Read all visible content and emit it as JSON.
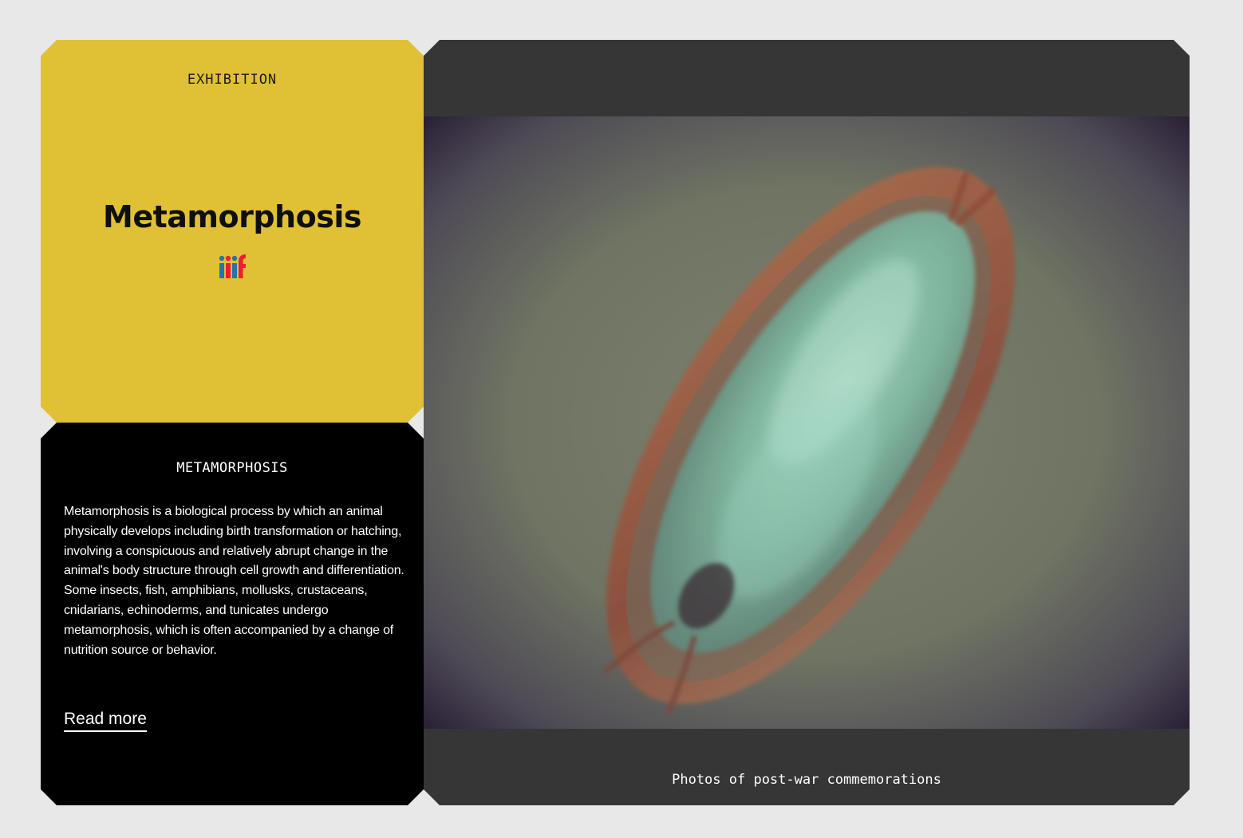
{
  "exhibition": {
    "kicker": "EXHIBITION",
    "title": "Metamorphosis",
    "logo_icon": "iiif-logo-icon",
    "accent_color": "#e0c135"
  },
  "description": {
    "heading": "METAMORPHOSIS",
    "body": "Metamorphosis is a biological process by which an animal physically develops including birth transformation or hatching, involving a conspicuous and relatively abrupt change in the animal's body structure through cell growth and differentiation. Some insects, fish, amphibians, mollusks, crustaceans, cnidarians, echinoderms, and tunicates undergo metamorphosis, which is often accompanied by a change of nutrition source or behavior.",
    "read_more_label": "Read more"
  },
  "media": {
    "image_alt": "Micrograph of a translucent pupa in a brown casing",
    "caption": "Photos of post-war commemorations"
  }
}
